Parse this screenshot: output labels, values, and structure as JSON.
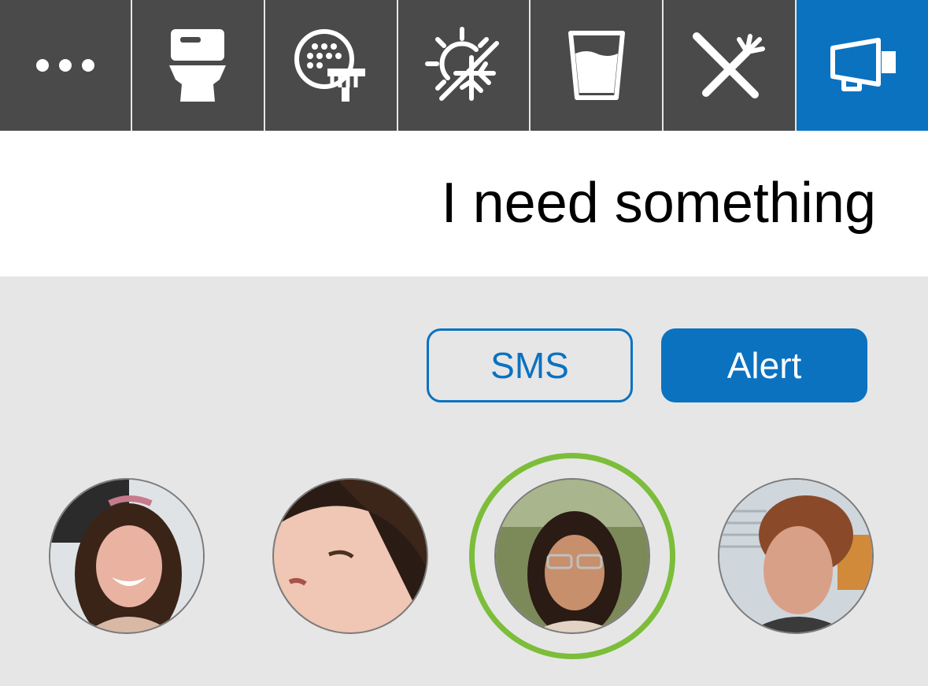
{
  "toolbar": {
    "items": [
      {
        "icon": "more-icon",
        "label": ""
      },
      {
        "icon": "toilet-icon",
        "label": ""
      },
      {
        "icon": "shower-icon",
        "label": ""
      },
      {
        "icon": "temperature-icon",
        "label": ""
      },
      {
        "icon": "drink-icon",
        "label": ""
      },
      {
        "icon": "food-icon",
        "label": ""
      },
      {
        "icon": "megaphone-icon",
        "label": ""
      }
    ],
    "active_index": 6,
    "colors": {
      "background": "#4a4a4a",
      "active": "#0b72c0"
    }
  },
  "header": {
    "title": "I need something"
  },
  "actions": {
    "sms_label": "SMS",
    "alert_label": "Alert",
    "accent": "#0b72c0"
  },
  "contacts": {
    "selected_index": 2,
    "selection_color": "#7cbd3a",
    "items": [
      {
        "icon": "avatar-photo"
      },
      {
        "icon": "avatar-photo"
      },
      {
        "icon": "avatar-photo"
      },
      {
        "icon": "avatar-photo"
      }
    ]
  }
}
